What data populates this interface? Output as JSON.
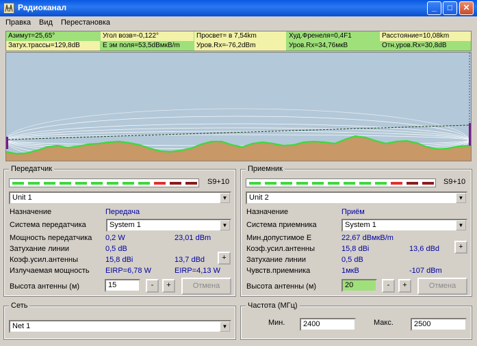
{
  "window": {
    "title": "Радиоканал",
    "buttons": {
      "minimize": "_",
      "maximize": "□",
      "close": "✕"
    }
  },
  "menu": [
    "Правка",
    "Вид",
    "Перестановка"
  ],
  "info": {
    "row1": [
      "Азимут=25,65°",
      "Угол возв=-0,122°",
      "Просвет= в 7,54km",
      "Худ.Френеля=0,4F1",
      "Расстояние=10,08km"
    ],
    "row2": [
      "Затух.трассы=129,8dB",
      "Е эм поля=53,5dBмкВ/m",
      "Уров.Rx=-76,2dBm",
      "Уров.Rx=34,76мкВ",
      "Отн.уров.Rx=30,8dB"
    ]
  },
  "colors": {
    "terrain_fill": "#c89866",
    "terrain_line": "#3ed83e",
    "sky": "#b3c8d8",
    "signal_on": "#3ed83e",
    "signal_red": "#e03030",
    "signal_dark": "#8a1c1c",
    "highlight_input": "#9fe07a",
    "info_yellow": "#f2f2a8",
    "info_green": "#9fe07a"
  },
  "transmitter": {
    "legend": "Передатчик",
    "signal_level": "S9+10",
    "signal_segments": {
      "green": 9,
      "red": 1,
      "dark": 2
    },
    "unit": "Unit   1",
    "rows": {
      "purpose_label": "Назначение",
      "purpose_value": "Передача",
      "system_label": "Система передатчика",
      "system_value": "System   1",
      "power_label": "Мощность передатчика",
      "power_w": "0,2 W",
      "power_dbm": "23,01 dBm",
      "loss_label": "Затухание линии",
      "loss_value": "0,5 dB",
      "gain_label": "Коэф.усил.антенны",
      "gain_dbi": "15,8 dBi",
      "gain_dbd": "13,7 dBd",
      "gain_plus": "+",
      "eirp_label": "Излучаемая мощность",
      "eirp_w": "EIRP=6,78 W",
      "eirp_dbw": "EIRP=4,13 W",
      "height_label": "Высота антенны (м)",
      "height_value": "15",
      "minus": "-",
      "plus": "+",
      "cancel": "Отмена"
    }
  },
  "receiver": {
    "legend": "Приемник",
    "signal_level": "S9+10",
    "signal_segments": {
      "green": 9,
      "red": 1,
      "dark": 2
    },
    "unit": "Unit   2",
    "rows": {
      "purpose_label": "Назначение",
      "purpose_value": "Приём",
      "system_label": "Система приемника",
      "system_value": "System   1",
      "mine_label": "Мин.допустимое Е",
      "mine_value": "22,67 dBмкВ/m",
      "gain_label": "Коэф.усил.антенны",
      "gain_dbi": "15,8 dBi",
      "gain_dbd": "13,6 dBd",
      "gain_plus": "+",
      "loss_label": "Затухание линии",
      "loss_value": "0,5 dB",
      "sens_label": "Чувств.приемника",
      "sens_uv": "1мкВ",
      "sens_dbm": "-107 dBm",
      "height_label": "Высота антенны (м)",
      "height_value": "20",
      "minus": "-",
      "plus": "+",
      "cancel": "Отмена"
    }
  },
  "network": {
    "legend": "Сеть",
    "value": "Net  1"
  },
  "frequency": {
    "legend": "Частота (МГц)",
    "min_label": "Мин.",
    "min_value": "2400",
    "max_label": "Макс.",
    "max_value": "2500"
  }
}
